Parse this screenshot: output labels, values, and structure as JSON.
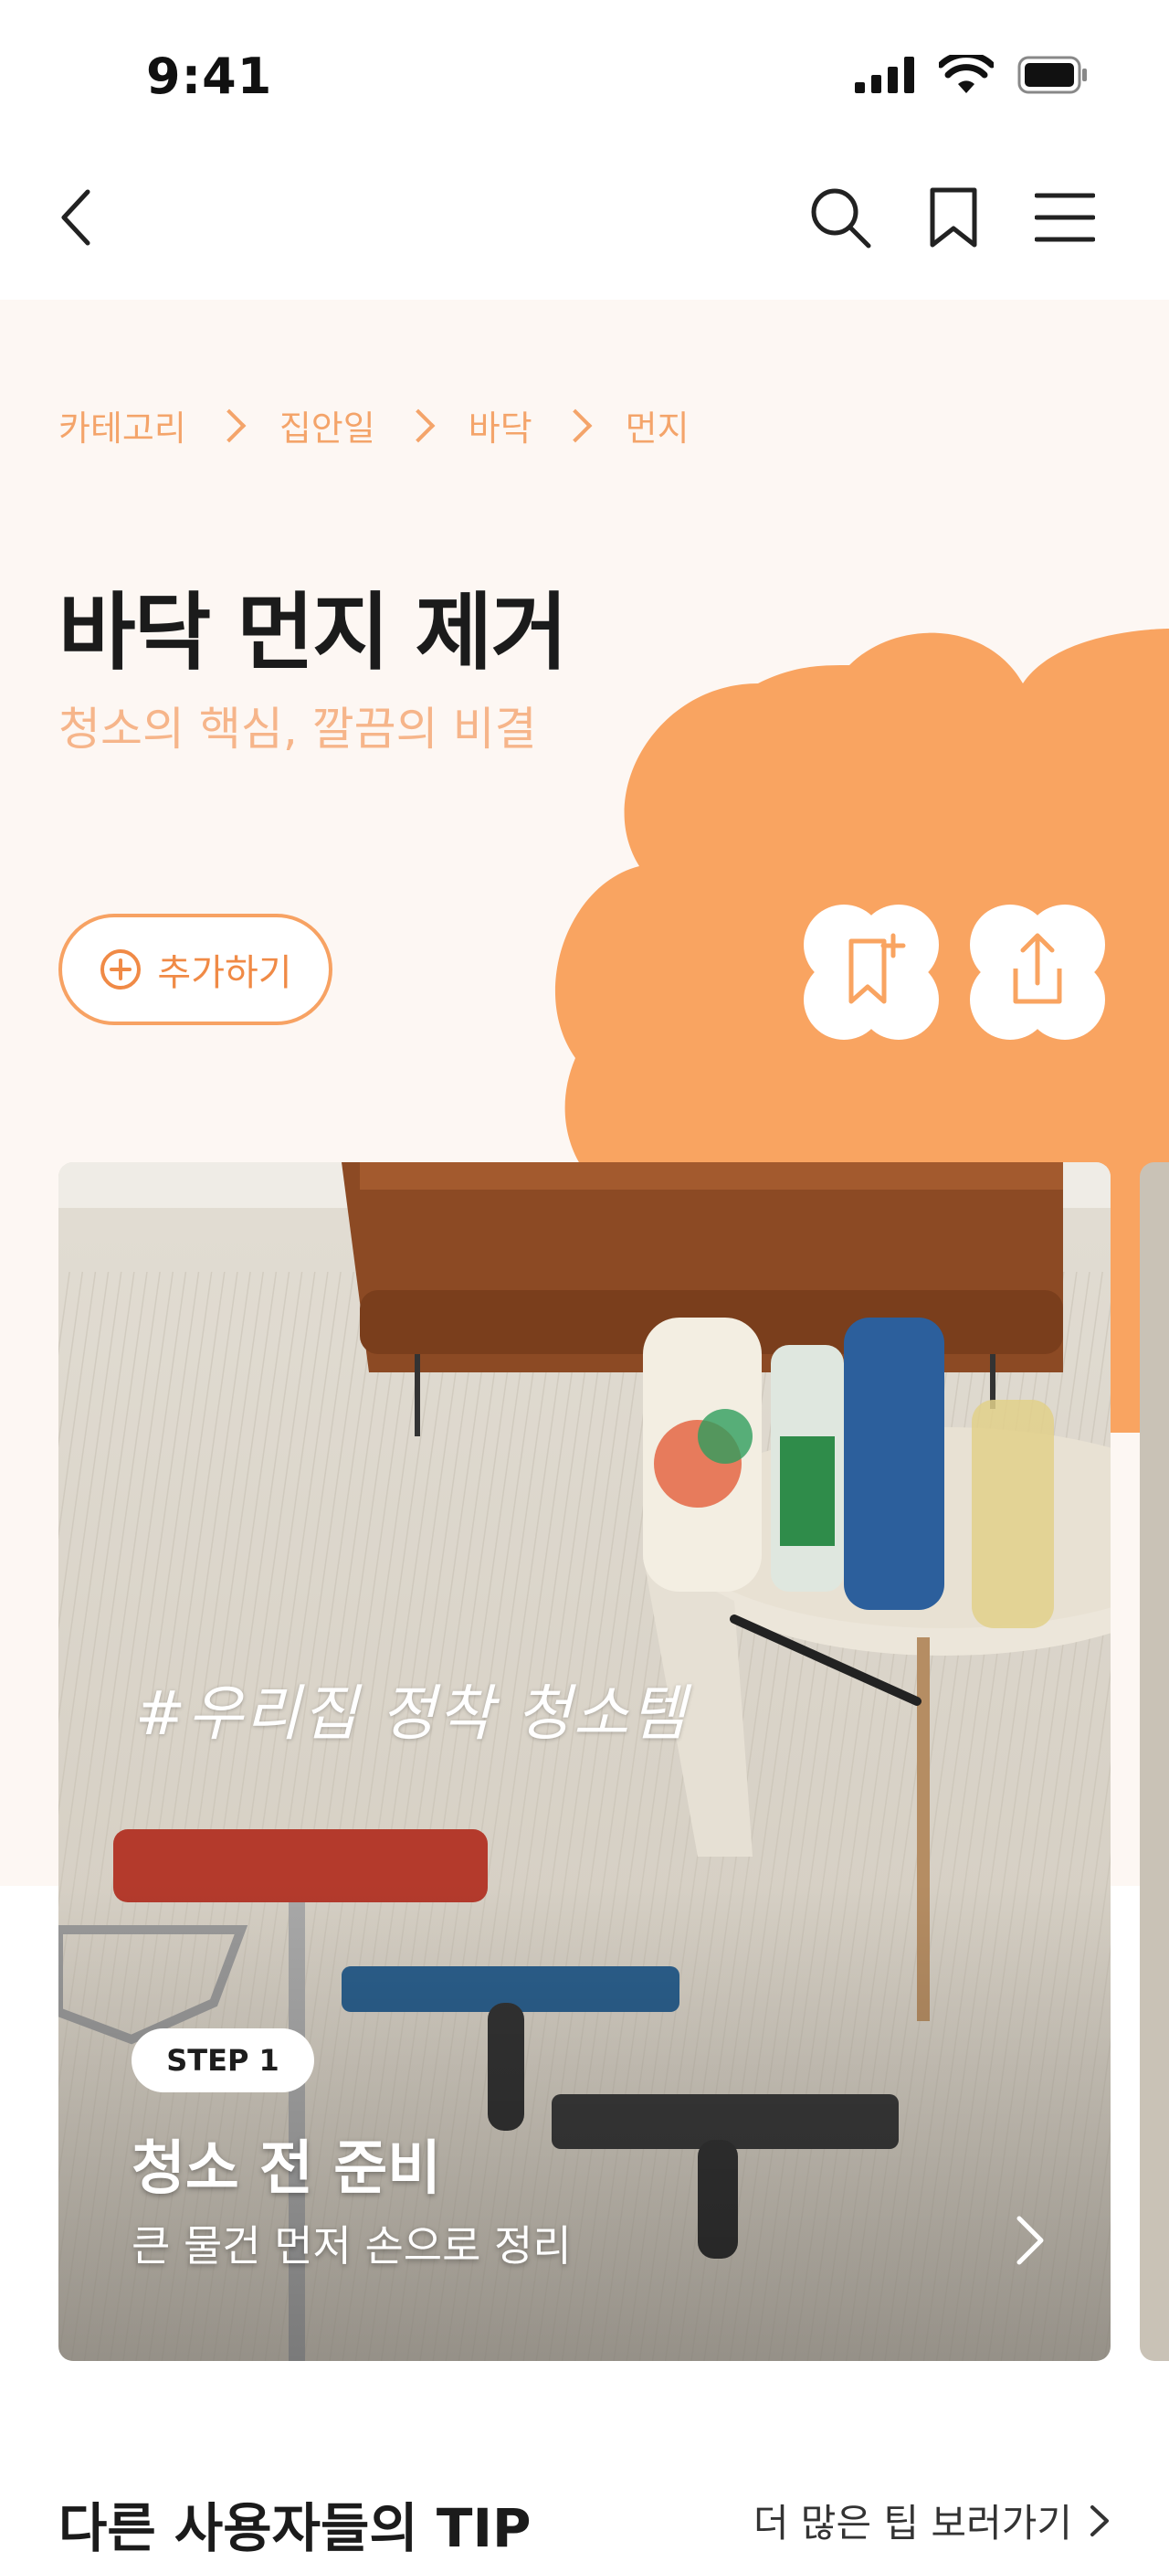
{
  "status_bar": {
    "time": "9:41"
  },
  "nav": {
    "back_icon": "chevron-left-icon",
    "search_icon": "search-icon",
    "bookmark_icon": "bookmark-icon",
    "menu_icon": "hamburger-menu-icon"
  },
  "breadcrumb": [
    "카테고리",
    "집안일",
    "바닥",
    "먼지"
  ],
  "hero": {
    "title": "바닥 먼지 제거",
    "subtitle": "청소의 핵심, 깔끔의 비결",
    "add_label": "추가하기",
    "accent_color": "#f9a461",
    "background_color": "#fdf7f3"
  },
  "card": {
    "hashtag": "#우리집 정착 청소템",
    "step_label": "STEP 1",
    "step_title": "청소 전 준비",
    "step_desc": "큰 물건 먼저 손으로 정리"
  },
  "tips": {
    "title": "다른 사용자들의 TIP",
    "more_label": "더 많은 팁 보러가기"
  }
}
